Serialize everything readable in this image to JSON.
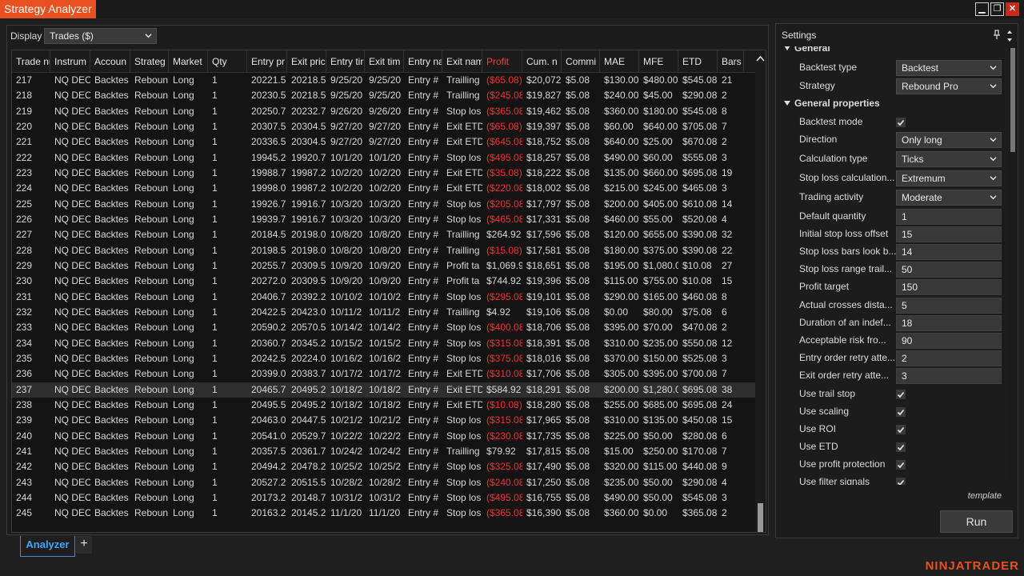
{
  "app": {
    "title": "Strategy Analyzer",
    "window_buttons": {
      "minimize": "▁",
      "restore": "❐",
      "close": "✕"
    },
    "logo": "NINJATRADER",
    "accent": "#e8501f"
  },
  "display": {
    "label": "Display",
    "value": "Trades ($)"
  },
  "grid": {
    "columns": [
      "Trade nu",
      "Instrum",
      "Accoun",
      "Strateg",
      "Market",
      "Qty",
      "Entry pr",
      "Exit pric",
      "Entry tir",
      "Exit tim",
      "Entry na",
      "Exit nam",
      "Profit",
      "Cum. n",
      "Commi",
      "MAE",
      "MFE",
      "ETD",
      "Bars"
    ],
    "rows": [
      [
        "217",
        "NQ DEC",
        "Backtes",
        "Reboun",
        "Long",
        "1",
        "20221.5",
        "20218.5",
        "9/25/20",
        "9/25/20",
        "Entry #",
        "Trailling",
        "($65.08)",
        "$20,072",
        "$5.08",
        "$130.00",
        "$480.00",
        "$545.08",
        "21"
      ],
      [
        "218",
        "NQ DEC",
        "Backtes",
        "Reboun",
        "Long",
        "1",
        "20230.5",
        "20218.5",
        "9/25/20",
        "9/25/20",
        "Entry #",
        "Trailling",
        "($245.08)",
        "$19,827",
        "$5.08",
        "$240.00",
        "$45.00",
        "$290.08",
        "2"
      ],
      [
        "219",
        "NQ DEC",
        "Backtes",
        "Reboun",
        "Long",
        "1",
        "20250.7",
        "20232.7",
        "9/26/20",
        "9/26/20",
        "Entry #",
        "Stop los",
        "($365.08)",
        "$19,462",
        "$5.08",
        "$360.00",
        "$180.00",
        "$545.08",
        "8"
      ],
      [
        "220",
        "NQ DEC",
        "Backtes",
        "Reboun",
        "Long",
        "1",
        "20307.5",
        "20304.5",
        "9/27/20",
        "9/27/20",
        "Entry #",
        "Exit ETD",
        "($65.08)",
        "$19,397",
        "$5.08",
        "$60.00",
        "$640.00",
        "$705.08",
        "7"
      ],
      [
        "221",
        "NQ DEC",
        "Backtes",
        "Reboun",
        "Long",
        "1",
        "20336.5",
        "20304.5",
        "9/27/20",
        "9/27/20",
        "Entry #",
        "Exit ETD",
        "($645.08)",
        "$18,752",
        "$5.08",
        "$640.00",
        "$25.00",
        "$670.08",
        "2"
      ],
      [
        "222",
        "NQ DEC",
        "Backtes",
        "Reboun",
        "Long",
        "1",
        "19945.2",
        "19920.7",
        "10/1/20",
        "10/1/20",
        "Entry #",
        "Stop los",
        "($495.08)",
        "$18,257",
        "$5.08",
        "$490.00",
        "$60.00",
        "$555.08",
        "3"
      ],
      [
        "223",
        "NQ DEC",
        "Backtes",
        "Reboun",
        "Long",
        "1",
        "19988.7",
        "19987.2",
        "10/2/20",
        "10/2/20",
        "Entry #",
        "Exit ETD",
        "($35.08)",
        "$18,222",
        "$5.08",
        "$135.00",
        "$660.00",
        "$695.08",
        "19"
      ],
      [
        "224",
        "NQ DEC",
        "Backtes",
        "Reboun",
        "Long",
        "1",
        "19998.0",
        "19987.2",
        "10/2/20",
        "10/2/20",
        "Entry #",
        "Exit ETD",
        "($220.08)",
        "$18,002",
        "$5.08",
        "$215.00",
        "$245.00",
        "$465.08",
        "3"
      ],
      [
        "225",
        "NQ DEC",
        "Backtes",
        "Reboun",
        "Long",
        "1",
        "19926.7",
        "19916.7",
        "10/3/20",
        "10/3/20",
        "Entry #",
        "Stop los",
        "($205.08)",
        "$17,797",
        "$5.08",
        "$200.00",
        "$405.00",
        "$610.08",
        "14"
      ],
      [
        "226",
        "NQ DEC",
        "Backtes",
        "Reboun",
        "Long",
        "1",
        "19939.7",
        "19916.7",
        "10/3/20",
        "10/3/20",
        "Entry #",
        "Stop los",
        "($465.08)",
        "$17,331",
        "$5.08",
        "$460.00",
        "$55.00",
        "$520.08",
        "4"
      ],
      [
        "227",
        "NQ DEC",
        "Backtes",
        "Reboun",
        "Long",
        "1",
        "20184.5",
        "20198.0",
        "10/8/20",
        "10/8/20",
        "Entry #",
        "Trailling",
        "$264.92",
        "$17,596",
        "$5.08",
        "$120.00",
        "$655.00",
        "$390.08",
        "32"
      ],
      [
        "228",
        "NQ DEC",
        "Backtes",
        "Reboun",
        "Long",
        "1",
        "20198.5",
        "20198.0",
        "10/8/20",
        "10/8/20",
        "Entry #",
        "Trailling",
        "($15.08)",
        "$17,581",
        "$5.08",
        "$180.00",
        "$375.00",
        "$390.08",
        "22"
      ],
      [
        "229",
        "NQ DEC",
        "Backtes",
        "Reboun",
        "Long",
        "1",
        "20255.7",
        "20309.5",
        "10/9/20",
        "10/9/20",
        "Entry #",
        "Profit ta",
        "$1,069.92",
        "$18,651",
        "$5.08",
        "$195.00",
        "$1,080.00",
        "$10.08",
        "27"
      ],
      [
        "230",
        "NQ DEC",
        "Backtes",
        "Reboun",
        "Long",
        "1",
        "20272.0",
        "20309.5",
        "10/9/20",
        "10/9/20",
        "Entry #",
        "Profit ta",
        "$744.92",
        "$19,396",
        "$5.08",
        "$115.00",
        "$755.00",
        "$10.08",
        "15"
      ],
      [
        "231",
        "NQ DEC",
        "Backtes",
        "Reboun",
        "Long",
        "1",
        "20406.7",
        "20392.2",
        "10/10/2",
        "10/10/2",
        "Entry #",
        "Stop los",
        "($295.08)",
        "$19,101",
        "$5.08",
        "$290.00",
        "$165.00",
        "$460.08",
        "8"
      ],
      [
        "232",
        "NQ DEC",
        "Backtes",
        "Reboun",
        "Long",
        "1",
        "20422.5",
        "20423.0",
        "10/11/2",
        "10/11/2",
        "Entry #",
        "Trailling",
        "$4.92",
        "$19,106",
        "$5.08",
        "$0.00",
        "$80.00",
        "$75.08",
        "6"
      ],
      [
        "233",
        "NQ DEC",
        "Backtes",
        "Reboun",
        "Long",
        "1",
        "20590.2",
        "20570.5",
        "10/14/2",
        "10/14/2",
        "Entry #",
        "Stop los",
        "($400.08)",
        "$18,706",
        "$5.08",
        "$395.00",
        "$70.00",
        "$470.08",
        "2"
      ],
      [
        "234",
        "NQ DEC",
        "Backtes",
        "Reboun",
        "Long",
        "1",
        "20360.7",
        "20345.2",
        "10/15/2",
        "10/15/2",
        "Entry #",
        "Stop los",
        "($315.08)",
        "$18,391",
        "$5.08",
        "$310.00",
        "$235.00",
        "$550.08",
        "12"
      ],
      [
        "235",
        "NQ DEC",
        "Backtes",
        "Reboun",
        "Long",
        "1",
        "20242.5",
        "20224.0",
        "10/16/2",
        "10/16/2",
        "Entry #",
        "Stop los",
        "($375.08)",
        "$18,016",
        "$5.08",
        "$370.00",
        "$150.00",
        "$525.08",
        "3"
      ],
      [
        "236",
        "NQ DEC",
        "Backtes",
        "Reboun",
        "Long",
        "1",
        "20399.0",
        "20383.7",
        "10/17/2",
        "10/17/2",
        "Entry #",
        "Exit ETD",
        "($310.08)",
        "$17,706",
        "$5.08",
        "$305.00",
        "$395.00",
        "$700.08",
        "7"
      ],
      [
        "237",
        "NQ DEC",
        "Backtes",
        "Reboun",
        "Long",
        "1",
        "20465.7",
        "20495.2",
        "10/18/2",
        "10/18/2",
        "Entry #",
        "Exit ETD",
        "$584.92",
        "$18,291",
        "$5.08",
        "$200.00",
        "$1,280.00",
        "$695.08",
        "38"
      ],
      [
        "238",
        "NQ DEC",
        "Backtes",
        "Reboun",
        "Long",
        "1",
        "20495.5",
        "20495.2",
        "10/18/2",
        "10/18/2",
        "Entry #",
        "Exit ETD",
        "($10.08)",
        "$18,280",
        "$5.08",
        "$255.00",
        "$685.00",
        "$695.08",
        "24"
      ],
      [
        "239",
        "NQ DEC",
        "Backtes",
        "Reboun",
        "Long",
        "1",
        "20463.0",
        "20447.5",
        "10/21/2",
        "10/21/2",
        "Entry #",
        "Stop los",
        "($315.08)",
        "$17,965",
        "$5.08",
        "$310.00",
        "$135.00",
        "$450.08",
        "15"
      ],
      [
        "240",
        "NQ DEC",
        "Backtes",
        "Reboun",
        "Long",
        "1",
        "20541.0",
        "20529.7",
        "10/22/2",
        "10/22/2",
        "Entry #",
        "Stop los",
        "($230.08)",
        "$17,735",
        "$5.08",
        "$225.00",
        "$50.00",
        "$280.08",
        "6"
      ],
      [
        "241",
        "NQ DEC",
        "Backtes",
        "Reboun",
        "Long",
        "1",
        "20357.5",
        "20361.7",
        "10/24/2",
        "10/24/2",
        "Entry #",
        "Trailling",
        "$79.92",
        "$17,815",
        "$5.08",
        "$15.00",
        "$250.00",
        "$170.08",
        "7"
      ],
      [
        "242",
        "NQ DEC",
        "Backtes",
        "Reboun",
        "Long",
        "1",
        "20494.2",
        "20478.2",
        "10/25/2",
        "10/25/2",
        "Entry #",
        "Stop los",
        "($325.08)",
        "$17,490",
        "$5.08",
        "$320.00",
        "$115.00",
        "$440.08",
        "9"
      ],
      [
        "243",
        "NQ DEC",
        "Backtes",
        "Reboun",
        "Long",
        "1",
        "20527.2",
        "20515.5",
        "10/28/2",
        "10/28/2",
        "Entry #",
        "Stop los",
        "($240.08)",
        "$17,250",
        "$5.08",
        "$235.00",
        "$50.00",
        "$290.08",
        "4"
      ],
      [
        "244",
        "NQ DEC",
        "Backtes",
        "Reboun",
        "Long",
        "1",
        "20173.2",
        "20148.7",
        "10/31/2",
        "10/31/2",
        "Entry #",
        "Stop los",
        "($495.08)",
        "$16,755",
        "$5.08",
        "$490.00",
        "$50.00",
        "$545.08",
        "3"
      ],
      [
        "245",
        "NQ DEC",
        "Backtes",
        "Reboun",
        "Long",
        "1",
        "20163.2",
        "20145.2",
        "11/1/20",
        "11/1/20",
        "Entry #",
        "Stop los",
        "($365.08)",
        "$16,390",
        "$5.08",
        "$360.00",
        "$0.00",
        "$365.08",
        "2"
      ]
    ],
    "selected_row": 20
  },
  "settings": {
    "title": "Settings",
    "items": [
      {
        "type": "category",
        "label": "General",
        "partial": true
      },
      {
        "type": "select",
        "label": "Backtest type",
        "value": "Backtest"
      },
      {
        "type": "select",
        "label": "Strategy",
        "value": "Rebound Pro"
      },
      {
        "type": "category",
        "label": "General properties"
      },
      {
        "type": "checkbox",
        "label": "Backtest mode",
        "checked": true
      },
      {
        "type": "select",
        "label": "Direction",
        "value": "Only long"
      },
      {
        "type": "select",
        "label": "Calculation type",
        "value": "Ticks"
      },
      {
        "type": "select",
        "label": "Stop loss calculation...",
        "value": "Extremum"
      },
      {
        "type": "select",
        "label": "Trading activity",
        "value": "Moderate"
      },
      {
        "type": "input",
        "label": "Default quantity",
        "value": "1"
      },
      {
        "type": "input",
        "label": "Initial stop loss offset",
        "value": "15"
      },
      {
        "type": "input",
        "label": "Stop loss bars look b...",
        "value": "14"
      },
      {
        "type": "input",
        "label": "Stop loss range trail...",
        "value": "50"
      },
      {
        "type": "input",
        "label": "Profit target",
        "value": "150"
      },
      {
        "type": "input",
        "label": "Actual crosses dista...",
        "value": "5"
      },
      {
        "type": "input",
        "label": "Duration of an indef...",
        "value": "18"
      },
      {
        "type": "input",
        "label": "Acceptable risk fro...",
        "value": "90"
      },
      {
        "type": "input",
        "label": "Entry order retry atte...",
        "value": "2"
      },
      {
        "type": "input",
        "label": "Exit order retry atte...",
        "value": "3"
      },
      {
        "type": "checkbox",
        "label": "Use trail stop",
        "checked": true
      },
      {
        "type": "checkbox",
        "label": "Use scaling",
        "checked": true
      },
      {
        "type": "checkbox",
        "label": "Use ROI",
        "checked": true
      },
      {
        "type": "checkbox",
        "label": "Use ETD",
        "checked": true
      },
      {
        "type": "checkbox",
        "label": "Use profit protection",
        "checked": true
      },
      {
        "type": "checkbox",
        "label": "Use filter signals",
        "checked": true,
        "partial": true
      }
    ],
    "template_label": "template",
    "run_label": "Run"
  },
  "tabs": [
    {
      "label": "Analyzer",
      "active": true
    }
  ],
  "tab_add": "+",
  "colors": {
    "negative": "#ff2a2a",
    "tab_active": "#3fa7ff"
  }
}
